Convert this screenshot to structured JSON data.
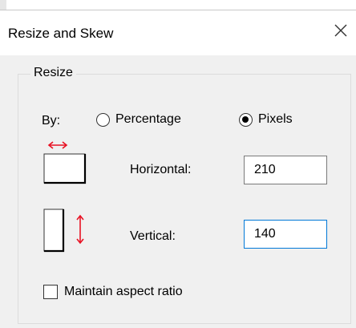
{
  "dialog": {
    "title": "Resize and Skew",
    "close_label": "×"
  },
  "resize_group": {
    "label": "Resize",
    "by_label": "By:",
    "options": [
      {
        "label": "Percentage",
        "selected": false
      },
      {
        "label": "Pixels",
        "selected": true
      }
    ],
    "horizontal": {
      "label": "Horizontal:",
      "value": "210"
    },
    "vertical": {
      "label": "Vertical:",
      "value": "140"
    },
    "maintain_aspect_ratio": {
      "label": "Maintain aspect ratio",
      "checked": false
    }
  },
  "colors": {
    "accent": "#0078d7",
    "arrow": "#e81123"
  },
  "icons": {
    "horizontal": "horizontal-resize-icon",
    "vertical": "vertical-resize-icon",
    "close": "close-icon"
  }
}
